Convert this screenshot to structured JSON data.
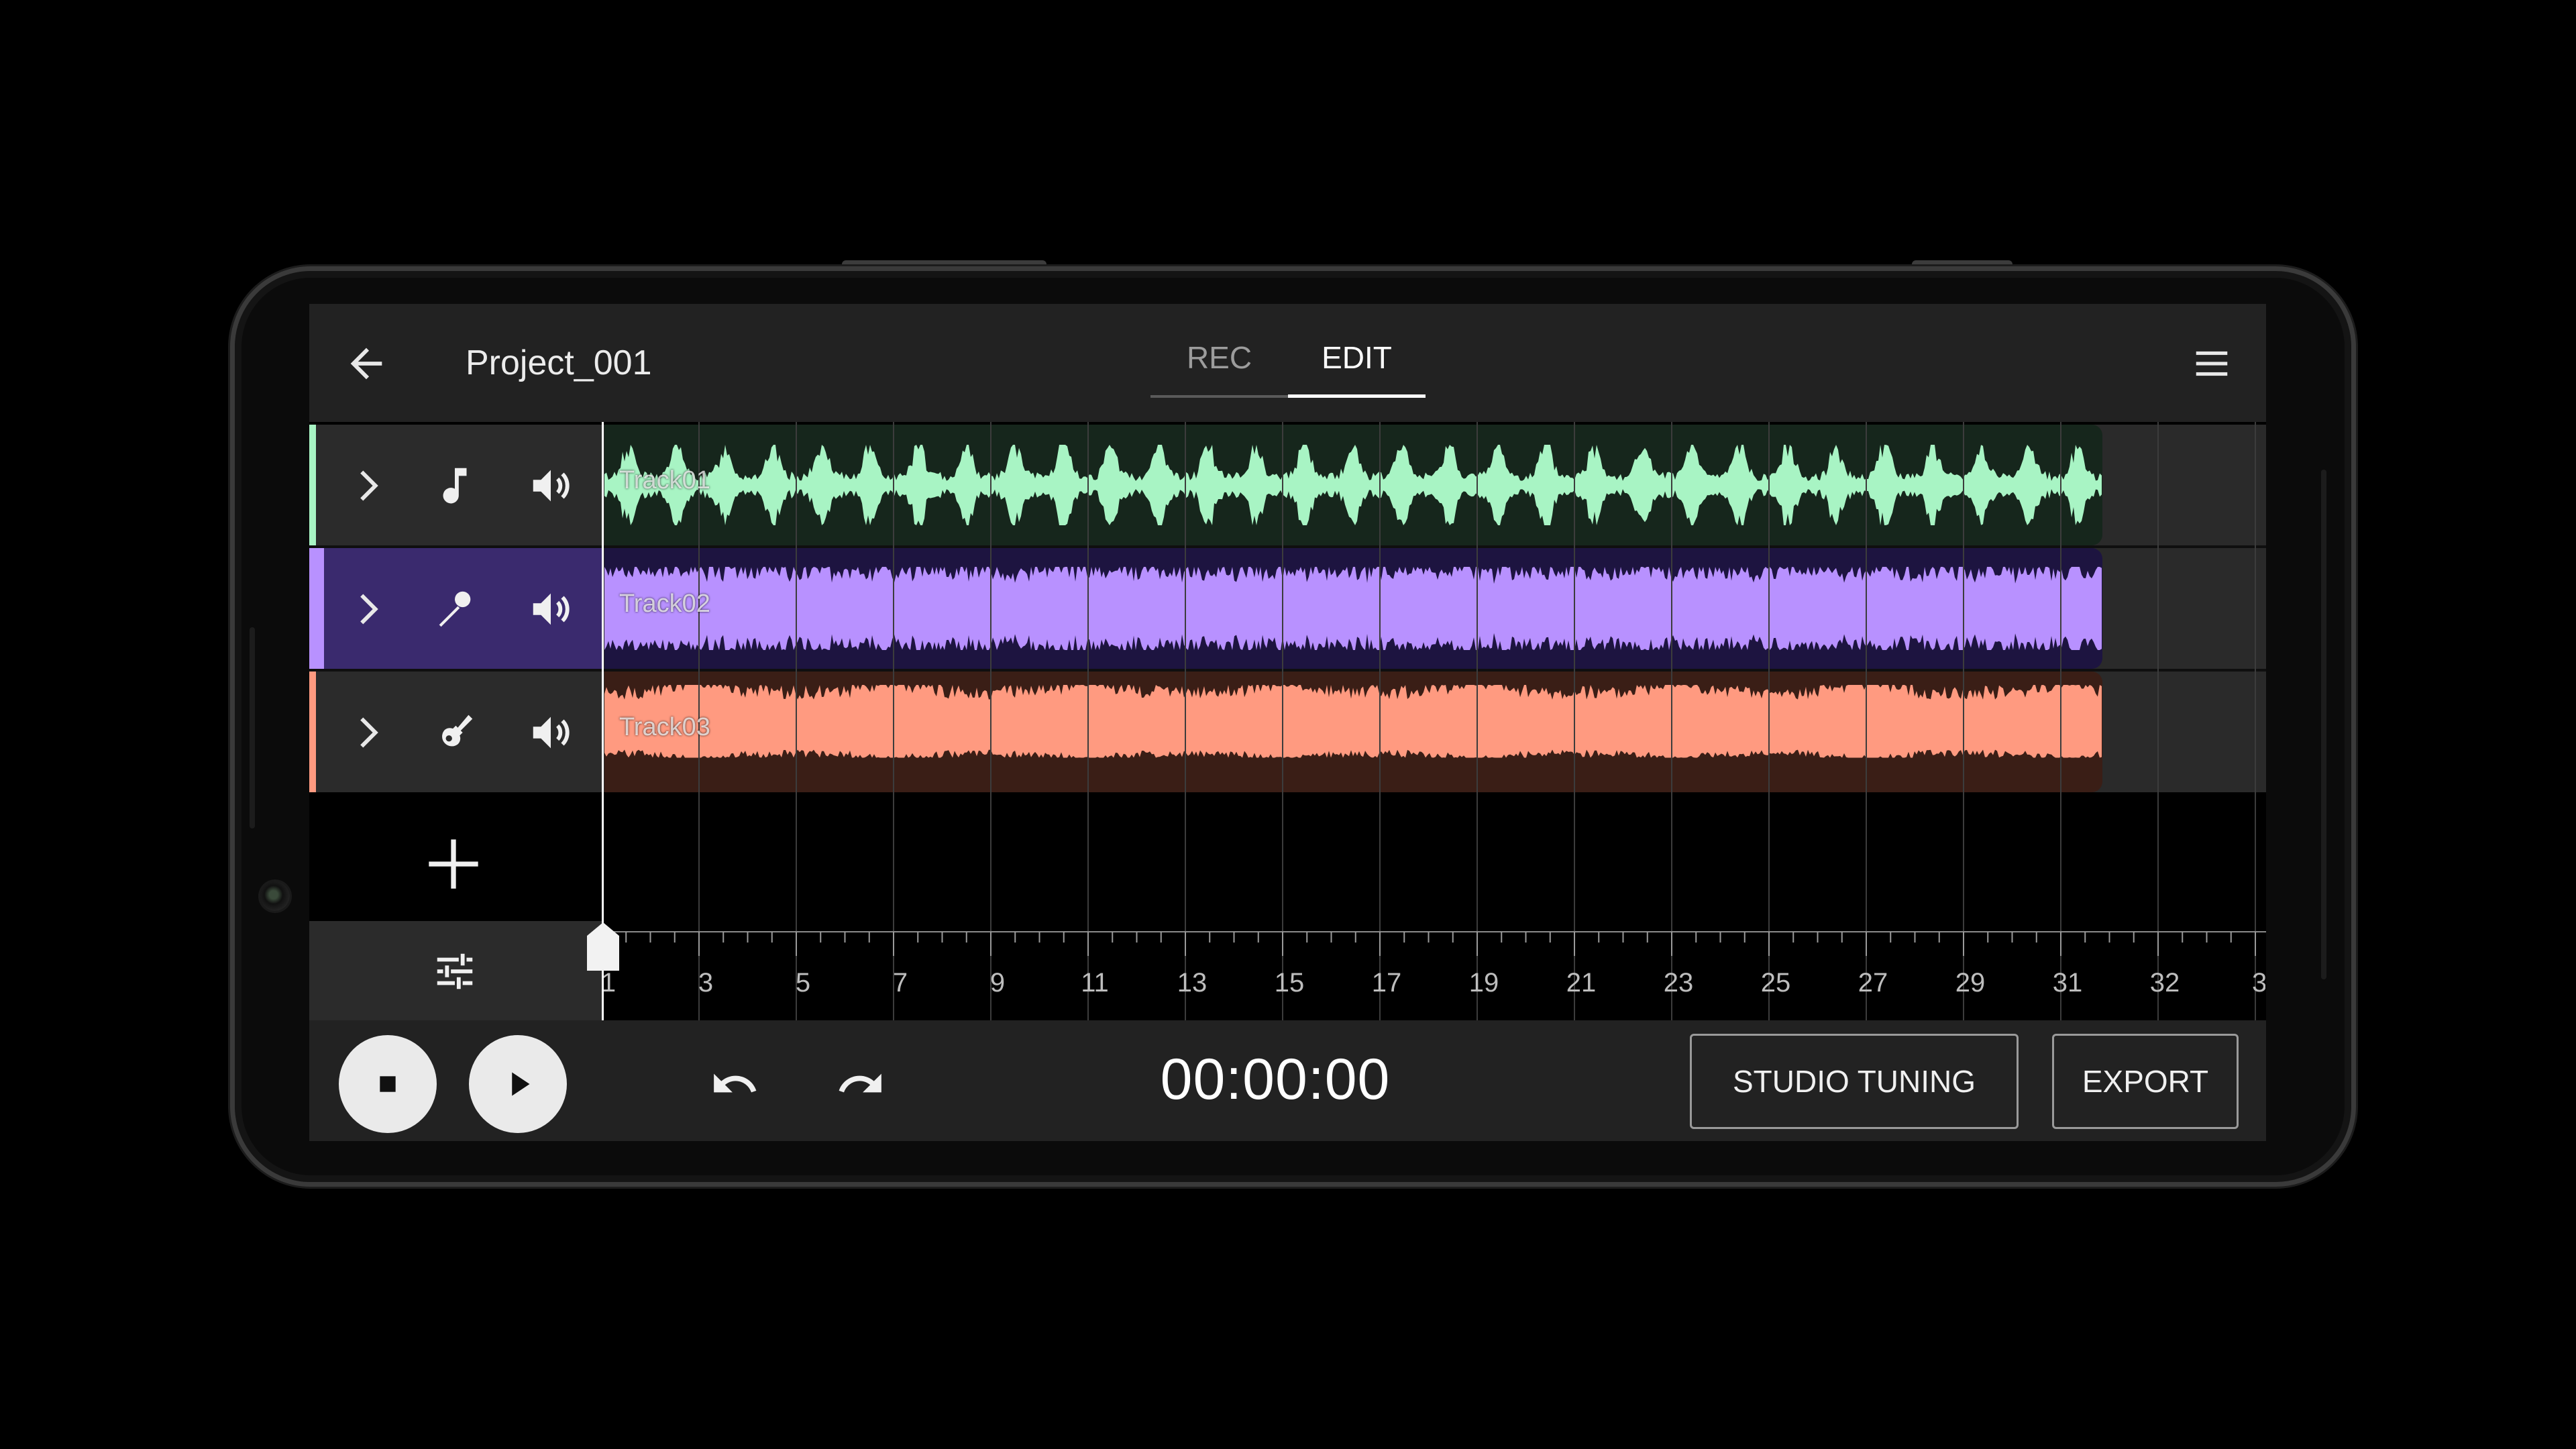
{
  "header": {
    "project_title": "Project_001",
    "tabs": [
      {
        "label": "REC",
        "selected": false
      },
      {
        "label": "EDIT",
        "selected": true
      }
    ]
  },
  "tracks": [
    {
      "name": "Track01",
      "instrument_icon": "music-note-icon",
      "color": "#a8f4c4",
      "bg": "#16261c",
      "header_bg": "#2b2b2b"
    },
    {
      "name": "Track02",
      "instrument_icon": "microphone-icon",
      "color": "#b891ff",
      "bg": "#1d1440",
      "header_bg": "#3a2a6e"
    },
    {
      "name": "Track03",
      "instrument_icon": "guitar-icon",
      "color": "#ff9a80",
      "bg": "#3a1e16",
      "header_bg": "#2b2b2b"
    }
  ],
  "ruler": {
    "labels": [
      "1",
      "3",
      "5",
      "7",
      "9",
      "11",
      "13",
      "15",
      "17",
      "19",
      "21",
      "23",
      "25",
      "27",
      "29",
      "31",
      "32",
      "3"
    ]
  },
  "transport": {
    "timecode": "00:00:00",
    "studio_tuning_label": "STUDIO TUNING",
    "export_label": "EXPORT"
  },
  "colors": {
    "accent_green": "#a8f4c4",
    "accent_purple": "#b891ff",
    "accent_orange": "#ff9a80",
    "panel": "#222222"
  }
}
